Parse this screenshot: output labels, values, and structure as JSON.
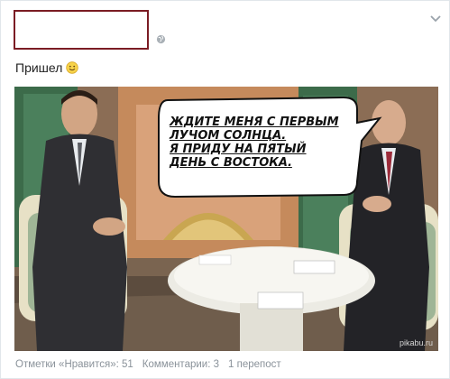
{
  "post": {
    "text": "Пришел",
    "emoji_icon": "smiley-icon",
    "header_icons": [
      "globe-icon",
      "chevron-down-icon"
    ]
  },
  "image": {
    "speech_lines": [
      "ЖДИТЕ МЕНЯ С ПЕРВЫМ",
      "ЛУЧОМ СОЛНЦА.",
      "Я ПРИДУ НА ПЯТЫЙ",
      "ДЕНЬ С ВОСТОКА."
    ],
    "watermark": "pikabu.ru"
  },
  "footer": {
    "likes": "Отметки «Нравится»: 51",
    "comments": "Комментарии: 3",
    "reposts": "1 перепост"
  },
  "colors": {
    "header_border": "#7b1c24",
    "stats_text": "#8a929a"
  }
}
